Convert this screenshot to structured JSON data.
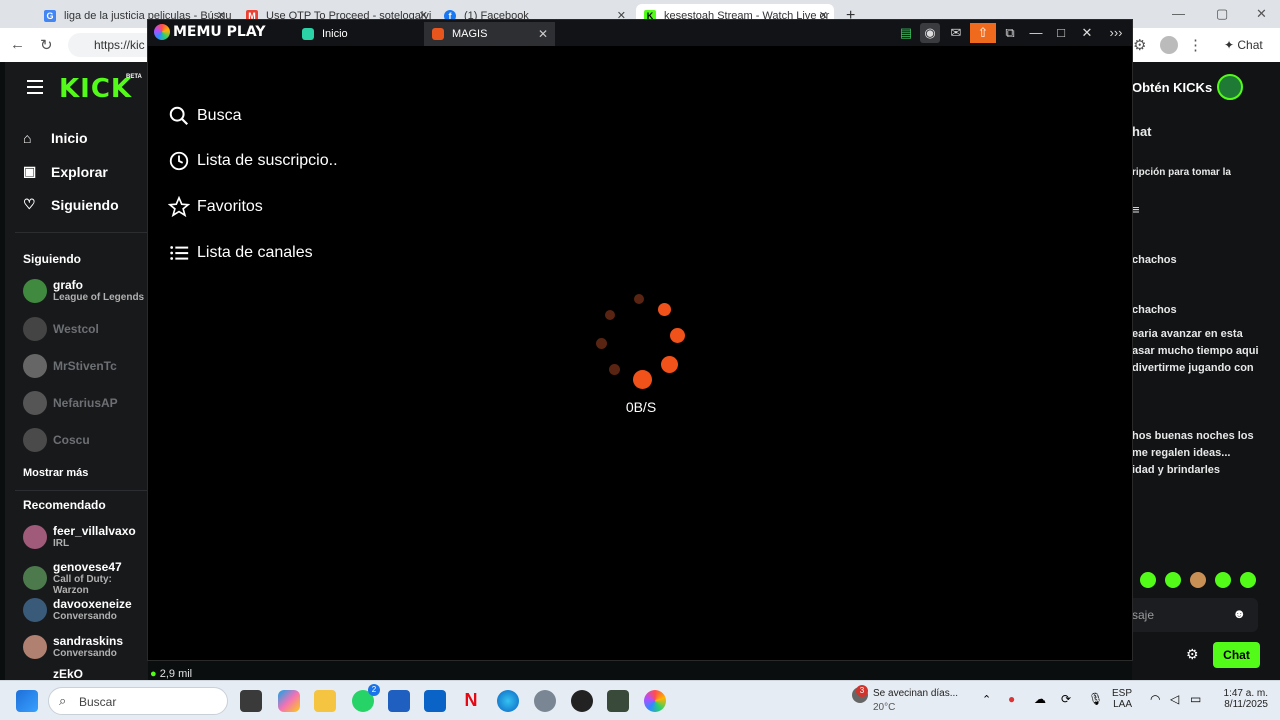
{
  "browser": {
    "tabs": [
      {
        "title": "liga de la justicia peliculas - Búsqu",
        "favicon": "G"
      },
      {
        "title": "Use OTP To Proceed - sotelogalvi",
        "favicon": "M"
      },
      {
        "title": "(1) Facebook",
        "favicon": "f"
      },
      {
        "title": "kesestoah Stream - Watch Live or",
        "favicon": "K"
      }
    ],
    "new_tab": "+",
    "address": "https://kic"
  },
  "kick": {
    "logo": "KICK",
    "beta": "BETA",
    "nav": [
      {
        "label": "Inicio",
        "icon": "home-icon"
      },
      {
        "label": "Explorar",
        "icon": "browse-icon"
      },
      {
        "label": "Siguiendo",
        "icon": "heart-icon"
      }
    ],
    "following_header": "Siguiendo",
    "following": [
      {
        "name": "grafo",
        "sub": "League of Legends",
        "online": true
      },
      {
        "name": "Westcol",
        "sub": "",
        "online": false
      },
      {
        "name": "MrStivenTc",
        "sub": "",
        "online": false
      },
      {
        "name": "NefariusAP",
        "sub": "",
        "online": false
      },
      {
        "name": "Coscu",
        "sub": "",
        "online": false
      }
    ],
    "show_more": "Mostrar más",
    "recommended_header": "Recomendado",
    "recommended": [
      {
        "name": "feer_villalvaxo",
        "sub": "IRL"
      },
      {
        "name": "genovese47",
        "sub": "Call of Duty: Warzon"
      },
      {
        "name": "davooxeneize",
        "sub": "Conversando"
      },
      {
        "name": "sandraskins",
        "sub": "Conversando"
      }
    ],
    "partial_row": {
      "name": "zEkO",
      "viewers": "2,9 mil"
    },
    "get_kicks": "Obtén KICKs",
    "chat_title": "hat",
    "chat_lines": [
      "ripción para tomar la",
      "chachos",
      "chachos",
      "earia avanzar en esta",
      "asar mucho tiempo aqui",
      "divertirme jugando con",
      "hos buenas noches los",
      "me regalen ideas...",
      "idad y brindarles"
    ],
    "message_placeholder": "saje",
    "chat_button": "Chat"
  },
  "memu": {
    "logo": "MEMU PLAY",
    "tabs": [
      {
        "label": "Inicio",
        "color": "#2bd2a6"
      },
      {
        "label": "MAGIS",
        "color": "#e8561e"
      }
    ],
    "menu": [
      {
        "label": "Busca",
        "icon": "search-icon"
      },
      {
        "label": "Lista de suscripcio..",
        "icon": "clock-icon"
      },
      {
        "label": "Favoritos",
        "icon": "star-icon"
      },
      {
        "label": "Lista de canales",
        "icon": "list-icon"
      }
    ],
    "loading_speed": "0B/S",
    "accent": "#f0521a"
  },
  "taskbar": {
    "search_placeholder": "Buscar",
    "weather_text": "Se avecinan días...",
    "temperature": "20°C",
    "weather_badge": "3",
    "whatsapp_badge": "2",
    "language": "ESP",
    "layout": "LAA",
    "time": "1:47 a. m.",
    "date": "8/11/2025"
  }
}
